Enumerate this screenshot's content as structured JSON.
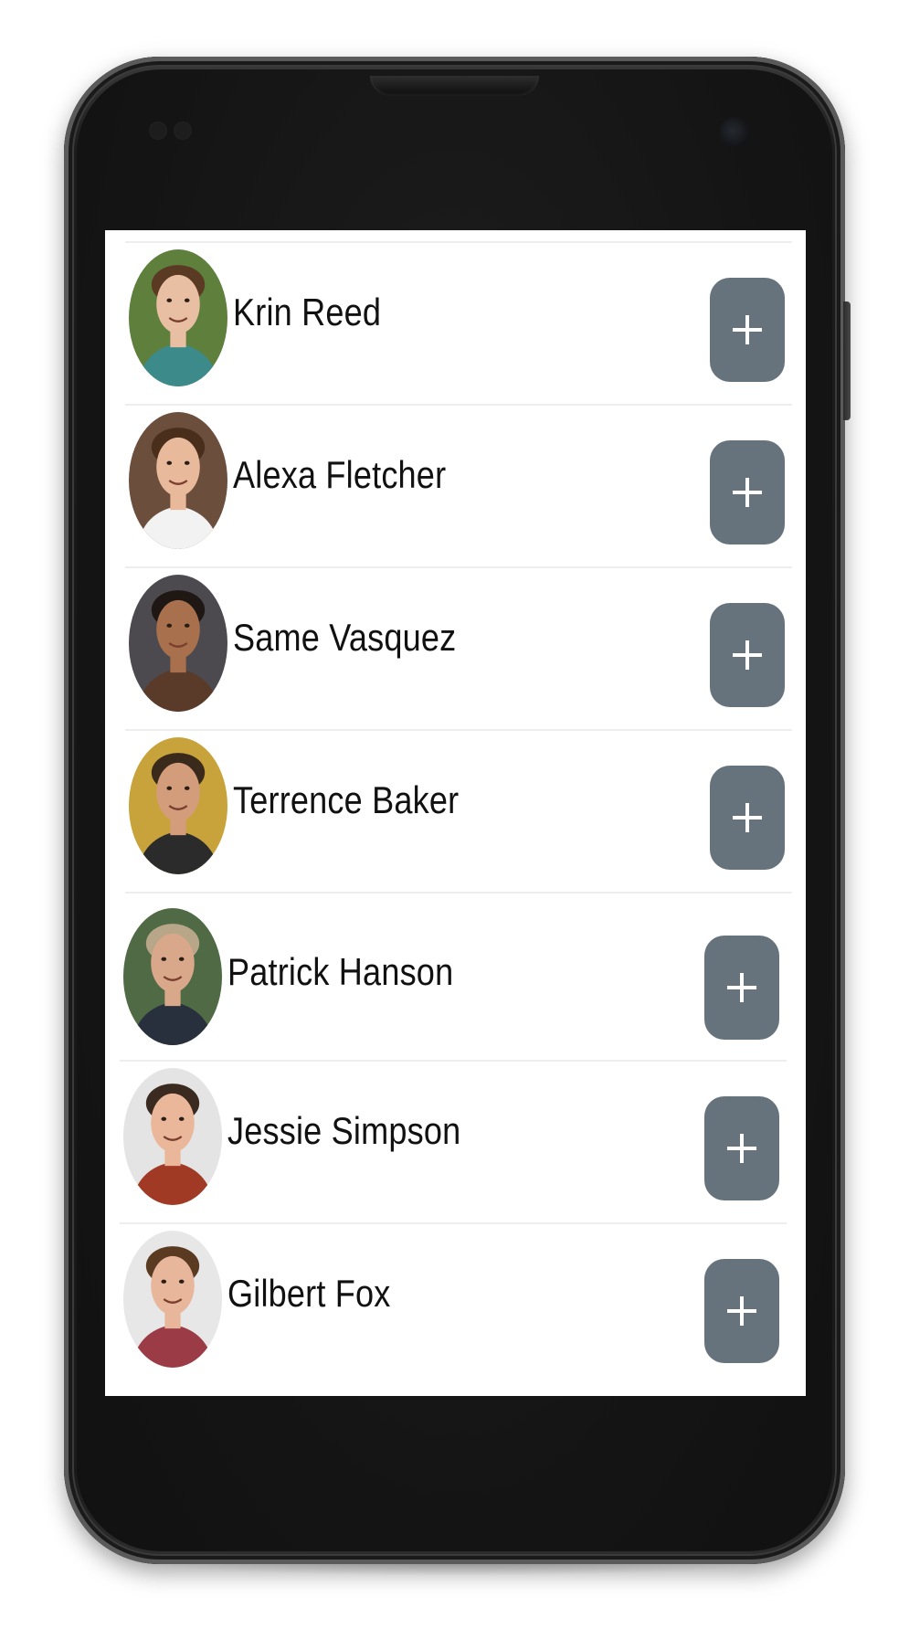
{
  "contacts": [
    {
      "name": "Krin Reed",
      "add_label": "+",
      "skin": "#e9bfa4",
      "hair": "#5a3a22",
      "shirt": "#3c8a8a",
      "bg": "#5f7f3c"
    },
    {
      "name": "Alexa Fletcher",
      "add_label": "+",
      "skin": "#e8b99a",
      "hair": "#4a2e1c",
      "shirt": "#f2f2f2",
      "bg": "#6b4e3b"
    },
    {
      "name": "Same Vasquez",
      "add_label": "+",
      "skin": "#a8704c",
      "hair": "#1e1713",
      "shirt": "#5a3b2a",
      "bg": "#4c4a4f"
    },
    {
      "name": "Terrence Baker",
      "add_label": "+",
      "skin": "#d39d7c",
      "hair": "#3a2a1c",
      "shirt": "#2b2b2b",
      "bg": "#c8a23a"
    },
    {
      "name": "Patrick Hanson",
      "add_label": "+",
      "skin": "#d9a88a",
      "hair": "#b8a689",
      "shirt": "#27303c",
      "bg": "#4f6a45"
    },
    {
      "name": "Jessie Simpson",
      "add_label": "+",
      "skin": "#eab79a",
      "hair": "#3b2a1f",
      "shirt": "#a03a25",
      "bg": "#e4e4e4"
    },
    {
      "name": "Gilbert Fox",
      "add_label": "+",
      "skin": "#e8b69a",
      "hair": "#5a3b22",
      "shirt": "#9b3b45",
      "bg": "#e7e7e7"
    }
  ]
}
